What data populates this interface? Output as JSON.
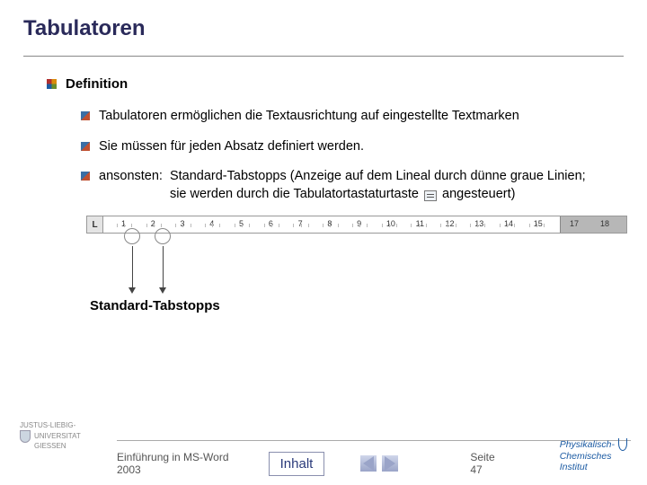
{
  "title": "Tabulatoren",
  "section_label": "Definition",
  "items": [
    "Tabulatoren ermöglichen die Textausrichtung auf eingestellte Textmarken",
    "Sie müssen für jeden Absatz definiert werden."
  ],
  "ansonsten": {
    "label": "ansonsten:",
    "text_before": "Standard-Tabstopps (Anzeige auf dem Lineal durch dünne graue Linien; sie werden durch die Tabulatortastaturtaste",
    "text_after": "angesteuert)"
  },
  "ruler": {
    "button_glyph": "L",
    "numbers": [
      "1",
      "2",
      "3",
      "4",
      "5",
      "6",
      "7",
      "8",
      "9",
      "10",
      "11",
      "12",
      "13",
      "14",
      "15"
    ],
    "end_numbers": [
      "17",
      "18"
    ]
  },
  "callout_label": "Standard-Tabstopps",
  "footer": {
    "uni_line1": "JUSTUS-LIEBIG-",
    "uni_line2": "UNIVERSITAT",
    "uni_line3": "GIESSEN",
    "doc_title": "Einführung in MS-Word 2003",
    "inhalt": "Inhalt",
    "page": "Seite 47",
    "inst_line1": "Physikalisch-",
    "inst_line2": "Chemisches",
    "inst_line3": "Institut"
  }
}
